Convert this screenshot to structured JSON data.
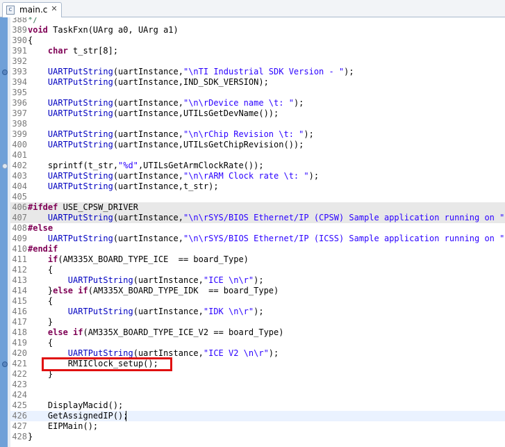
{
  "tab": {
    "label": "main.c",
    "file_icon": "c-file-icon",
    "close_icon": "close-icon"
  },
  "lines": [
    {
      "num": "388",
      "code": "*/"
    },
    {
      "num": "389",
      "code": "void TaskFxn(UArg a0, UArg a1)"
    },
    {
      "num": "390",
      "code": "{"
    },
    {
      "num": "391",
      "code": "    char t_str[8];"
    },
    {
      "num": "392",
      "code": ""
    },
    {
      "num": "393",
      "code": "    UARTPutString(uartInstance,\"\\nTI Industrial SDK Version - \");"
    },
    {
      "num": "394",
      "code": "    UARTPutString(uartInstance,IND_SDK_VERSION);"
    },
    {
      "num": "395",
      "code": ""
    },
    {
      "num": "396",
      "code": "    UARTPutString(uartInstance,\"\\n\\rDevice name \\t: \");"
    },
    {
      "num": "397",
      "code": "    UARTPutString(uartInstance,UTILsGetDevName());"
    },
    {
      "num": "398",
      "code": ""
    },
    {
      "num": "399",
      "code": "    UARTPutString(uartInstance,\"\\n\\rChip Revision \\t: \");"
    },
    {
      "num": "400",
      "code": "    UARTPutString(uartInstance,UTILsGetChipRevision());"
    },
    {
      "num": "401",
      "code": ""
    },
    {
      "num": "402",
      "code": "    sprintf(t_str,\"%d\",UTILsGetArmClockRate());"
    },
    {
      "num": "403",
      "code": "    UARTPutString(uartInstance,\"\\n\\rARM Clock rate \\t: \");"
    },
    {
      "num": "404",
      "code": "    UARTPutString(uartInstance,t_str);"
    },
    {
      "num": "405",
      "code": ""
    },
    {
      "num": "406",
      "code": "#ifdef USE_CPSW_DRIVER"
    },
    {
      "num": "407",
      "code": "    UARTPutString(uartInstance,\"\\n\\rSYS/BIOS Ethernet/IP (CPSW) Sample application running on \");"
    },
    {
      "num": "408",
      "code": "#else"
    },
    {
      "num": "409",
      "code": "    UARTPutString(uartInstance,\"\\n\\rSYS/BIOS Ethernet/IP (ICSS) Sample application running on \");"
    },
    {
      "num": "410",
      "code": "#endif"
    },
    {
      "num": "411",
      "code": "    if(AM335X_BOARD_TYPE_ICE  == board_Type)"
    },
    {
      "num": "412",
      "code": "    {"
    },
    {
      "num": "413",
      "code": "        UARTPutString(uartInstance,\"ICE \\n\\r\");"
    },
    {
      "num": "414",
      "code": "    }else if(AM335X_BOARD_TYPE_IDK  == board_Type)"
    },
    {
      "num": "415",
      "code": "    {"
    },
    {
      "num": "416",
      "code": "        UARTPutString(uartInstance,\"IDK \\n\\r\");"
    },
    {
      "num": "417",
      "code": "    }"
    },
    {
      "num": "418",
      "code": "    else if(AM335X_BOARD_TYPE_ICE_V2 == board_Type)"
    },
    {
      "num": "419",
      "code": "    {"
    },
    {
      "num": "420",
      "code": "        UARTPutString(uartInstance,\"ICE V2 \\n\\r\");"
    },
    {
      "num": "421",
      "code": "        RMIIClock_setup();"
    },
    {
      "num": "422",
      "code": "    }"
    },
    {
      "num": "423",
      "code": ""
    },
    {
      "num": "424",
      "code": ""
    },
    {
      "num": "425",
      "code": "    DisplayMacid();"
    },
    {
      "num": "426",
      "code": "    GetAssignedIP();"
    },
    {
      "num": "427",
      "code": "    EIPMain();"
    },
    {
      "num": "428",
      "code": "}"
    }
  ],
  "highlight": {
    "line": "421",
    "color": "#e01010"
  },
  "colors": {
    "ruler": "#6fa0d8",
    "keyword": "#7f0055",
    "string": "#2a00ff",
    "function": "#0000c0"
  }
}
